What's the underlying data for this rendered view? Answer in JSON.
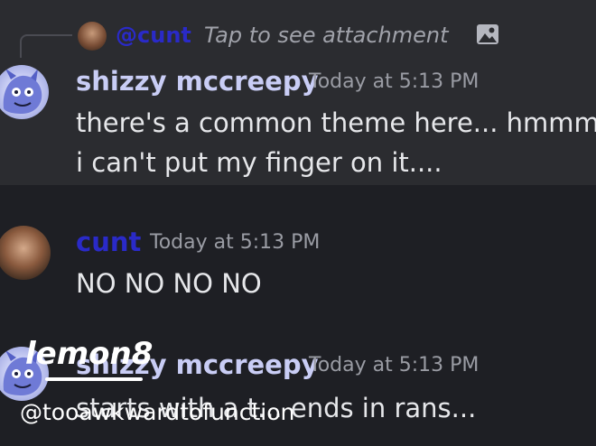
{
  "reply_preview": {
    "username": "@cunt",
    "text": "Tap to see attachment",
    "icon": "image-icon"
  },
  "messages": [
    {
      "username": "shizzy mccreepy",
      "username_color": "#c9cdf5",
      "timestamp": "Today at 5:13 PM",
      "lines": [
        "there's a common theme here... hmmm...",
        "i can't put my finger on it...."
      ],
      "avatar": "blue-creature-avatar"
    },
    {
      "username": "cunt",
      "username_color": "#2a2ac8",
      "timestamp": "Today at 5:13 PM",
      "lines": [
        "NO NO NO NO"
      ],
      "avatar": "person-avatar"
    },
    {
      "username": "shizzy mccreepy",
      "username_color": "#c9cdf5",
      "timestamp": "Today at 5:13 PM",
      "lines": [
        "starts with a t... ends in rans..."
      ],
      "avatar": "blue-creature-avatar"
    }
  ],
  "watermark": {
    "logo": "lemon8",
    "handle": "@tooawkwardtofunction"
  },
  "colors": {
    "background": "#1e1f24",
    "highlight": "#2b2c30",
    "timestamp": "#9a9ca4",
    "text": "#e6e7ea"
  }
}
